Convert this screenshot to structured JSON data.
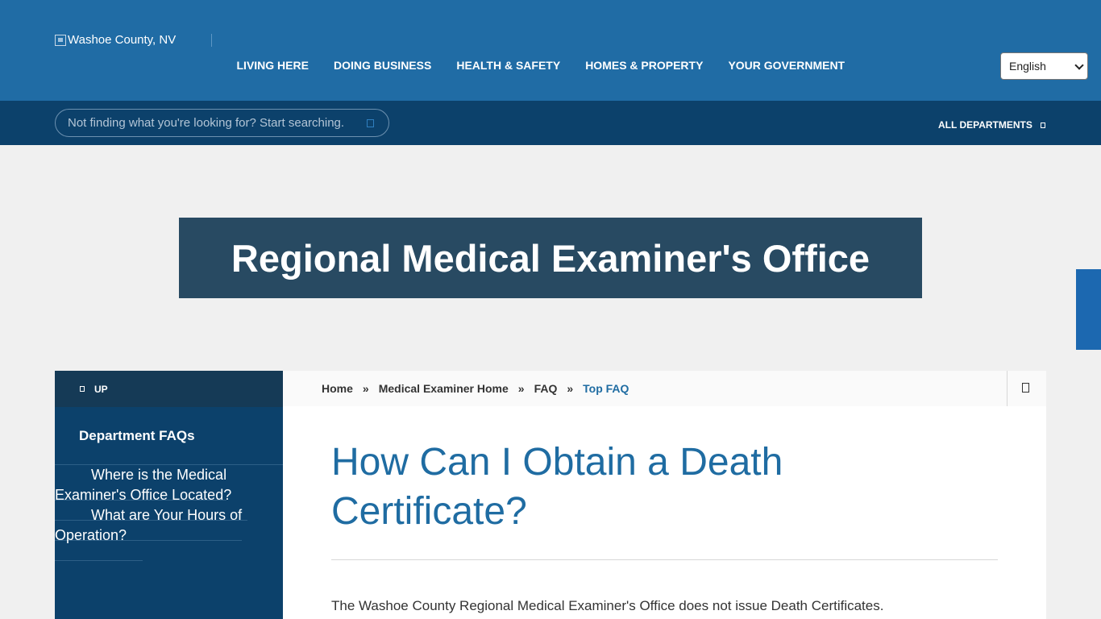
{
  "header": {
    "logo_alt": "Washoe County, NV",
    "nav": [
      "LIVING HERE",
      "DOING BUSINESS",
      "HEALTH & SAFETY",
      "HOMES & PROPERTY",
      "YOUR GOVERNMENT"
    ],
    "language": "English"
  },
  "search": {
    "placeholder": "Not finding what you're looking for? Start searching.",
    "all_departments": "ALL DEPARTMENTS"
  },
  "banner": {
    "title": "Regional Medical Examiner's Office"
  },
  "sidebar": {
    "up_label": "UP",
    "heading": "Department FAQs",
    "items": [
      "Where is the Medical Examiner's Office Located?",
      "What are Your Hours of Operation?"
    ]
  },
  "breadcrumb": [
    "Home",
    "Medical Examiner Home",
    "FAQ",
    "Top FAQ"
  ],
  "breadcrumb_separator": "»",
  "main": {
    "title": "How Can I Obtain a Death Certificate?",
    "answer": "The Washoe County Regional Medical Examiner's Office does not issue Death Certificates."
  },
  "colors": {
    "header_blue": "#206ca5",
    "search_bar_navy": "#0c416b",
    "banner_slate": "#284a62",
    "title_blue": "#1f6ca2"
  }
}
